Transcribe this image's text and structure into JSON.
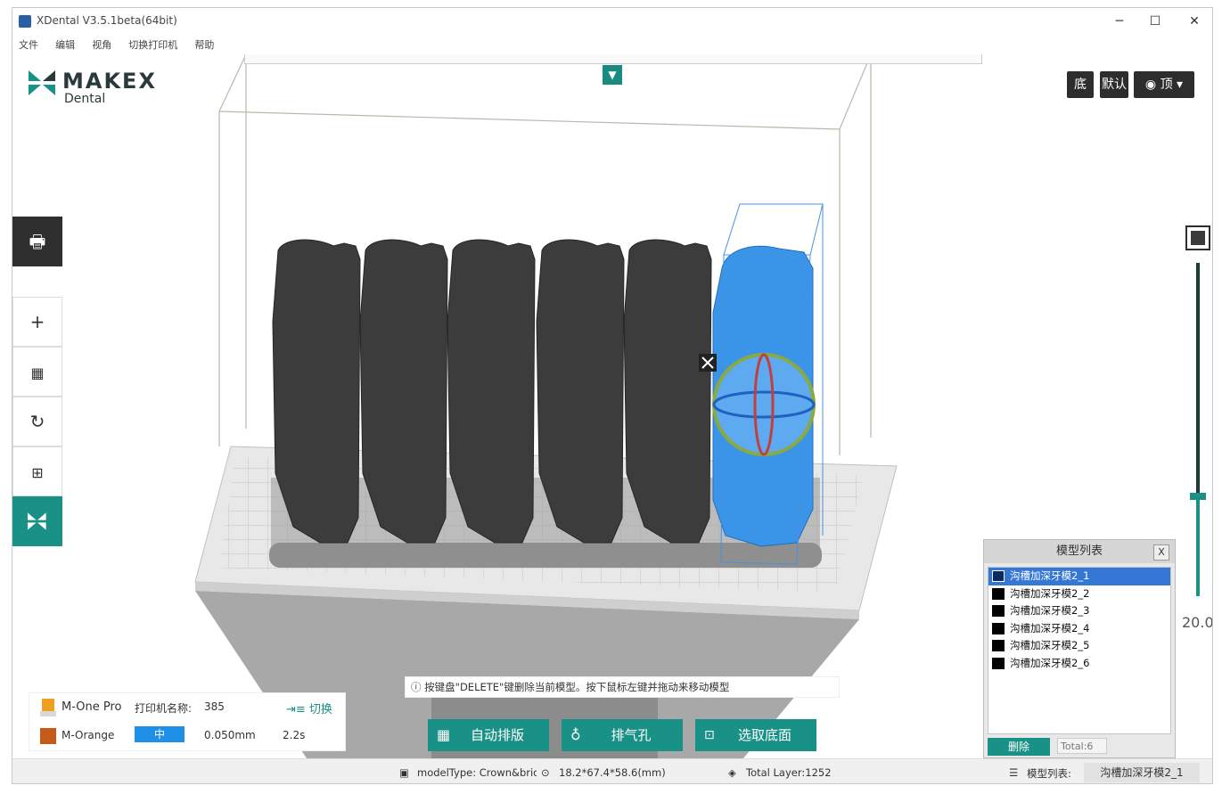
{
  "window": {
    "title": "XDental V3.5.1beta(64bit)",
    "minimize": "─",
    "maximize": "☐",
    "close": "✕"
  },
  "menu": [
    "文件",
    "编辑",
    "视角",
    "切换打印机",
    "帮助"
  ],
  "logo": {
    "brand": "MAKEX",
    "sub": "Dental"
  },
  "expand_icon": "chevron-down-icon",
  "view_buttons": {
    "bottom": "底",
    "default": "默认",
    "top": "顶"
  },
  "left_tools": [
    "printer-icon",
    "plus-icon",
    "layout-icon",
    "rotate-icon",
    "support-icon",
    "makex-icon"
  ],
  "slider": {
    "value": "20.0",
    "level_fraction": 0.26
  },
  "model_panel": {
    "title": "模型列表",
    "close": "X",
    "items": [
      "沟槽加深牙模2_1",
      "沟槽加深牙模2_2",
      "沟槽加深牙模2_3",
      "沟槽加深牙模2_4",
      "沟槽加深牙模2_5",
      "沟槽加深牙模2_6"
    ],
    "selected_index": 0,
    "delete": "删除",
    "total": "Total:6"
  },
  "printer": {
    "name": "M-One Pro",
    "name_label": "打印机名称:",
    "name_value": "385",
    "switch": "切换",
    "resin": "M-Orange",
    "quality": "中",
    "layer": "0.050mm",
    "exposure": "2.2s",
    "colors": {
      "printer_icon": "#f0a020",
      "resin_swatch": "#c85a18"
    }
  },
  "hint": "按键盘\"DELETE\"键删除当前模型。按下鼠标左键并拖动来移动模型",
  "actions": {
    "auto_layout": "自动排版",
    "vent": "排气孔",
    "select_bottom": "选取底面"
  },
  "status": {
    "model_type": "modelType: Crown&bridge",
    "dimensions": "18.2*67.4*58.6(mm)",
    "total_layer": "Total Layer:1252",
    "model_list_label": "模型列表:",
    "current_model": "沟槽加深牙模2_1"
  },
  "colors": {
    "accent": "#1a9186",
    "selection": "#3577d4",
    "model_selected": "#3a95e8",
    "model_dark": "#3c3c3c"
  }
}
